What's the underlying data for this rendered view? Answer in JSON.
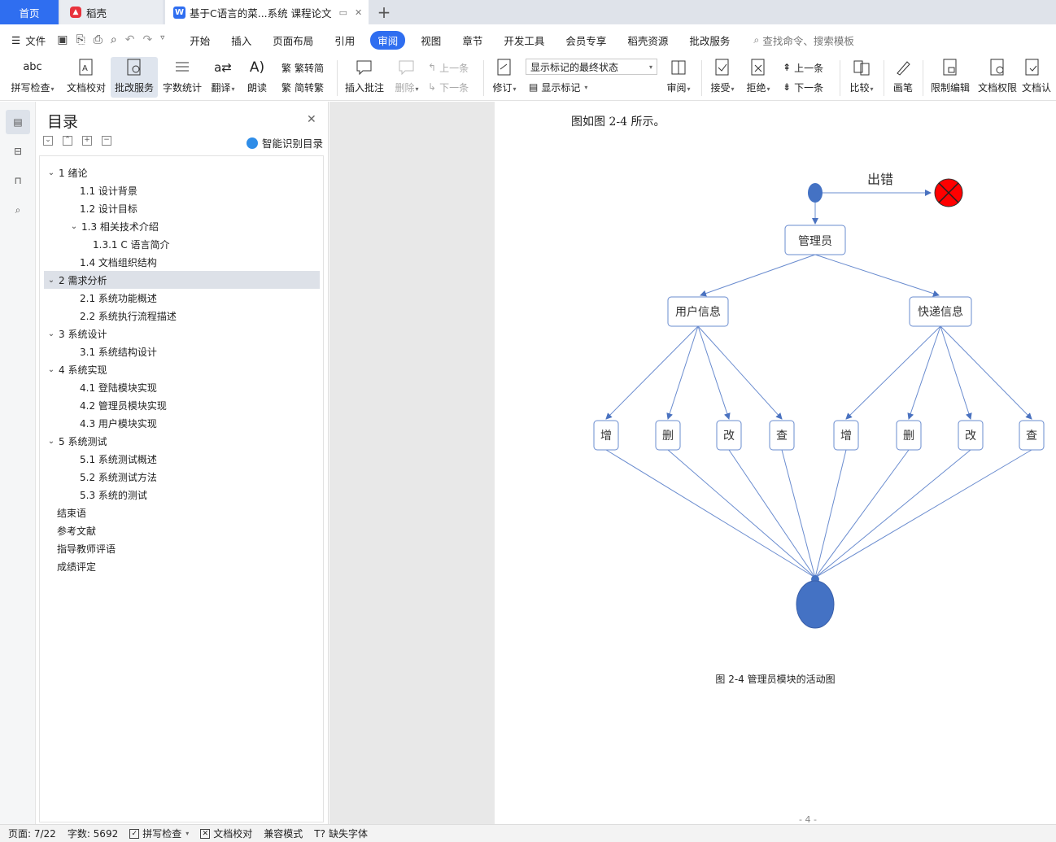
{
  "tabs": {
    "home": "首页",
    "daoke": "稻壳",
    "doc": "基于C语言的菜...系统 课程论文"
  },
  "menu": {
    "file": "文件",
    "items": [
      "开始",
      "插入",
      "页面布局",
      "引用",
      "审阅",
      "视图",
      "章节",
      "开发工具",
      "会员专享",
      "稻壳资源",
      "批改服务"
    ],
    "active": "审阅",
    "search_placeholder": "查找命令、搜索模板"
  },
  "ribbon": {
    "spell": "拼写检查",
    "proofread": "文档校对",
    "review_service": "批改服务",
    "word_count": "字数统计",
    "translate": "翻译",
    "read_aloud": "朗读",
    "trad": "繁转简",
    "simp": "简转繁",
    "insert_comment": "插入批注",
    "delete": "删除",
    "prev_comment": "上一条",
    "next_comment": "下一条",
    "revise": "修订",
    "status_select": "显示标记的最终状态",
    "show_markup": "显示标记",
    "review_pane": "审阅",
    "accept": "接受",
    "reject": "拒绝",
    "prev_change": "上一条",
    "next_change": "下一条",
    "compare": "比较",
    "pen": "画笔",
    "restrict": "限制编辑",
    "permission": "文档权限",
    "certify": "文档认"
  },
  "toc": {
    "title": "目录",
    "smart": "智能识别目录",
    "items": [
      {
        "text": "1  绪论",
        "level": 0,
        "chev": true
      },
      {
        "text": "1.1  设计背景",
        "level": 1,
        "chev": false
      },
      {
        "text": "1.2  设计目标",
        "level": 1,
        "chev": false
      },
      {
        "text": "1.3 相关技术介绍",
        "level": 1,
        "chev": true
      },
      {
        "text": "1.3.1 C 语言简介",
        "level": 2,
        "chev": false
      },
      {
        "text": "1.4  文档组织结构",
        "level": 1,
        "chev": false
      },
      {
        "text": "2  需求分析",
        "level": 0,
        "chev": true,
        "selected": true
      },
      {
        "text": "2.1  系统功能概述",
        "level": 1,
        "chev": false
      },
      {
        "text": "2.2  系统执行流程描述",
        "level": 1,
        "chev": false
      },
      {
        "text": "3  系统设计",
        "level": 0,
        "chev": true
      },
      {
        "text": "3.1  系统结构设计",
        "level": 1,
        "chev": false
      },
      {
        "text": "4  系统实现",
        "level": 0,
        "chev": true
      },
      {
        "text": "4.1  登陆模块实现",
        "level": 1,
        "chev": false
      },
      {
        "text": "4.2  管理员模块实现",
        "level": 1,
        "chev": false
      },
      {
        "text": "4.3  用户模块实现",
        "level": 1,
        "chev": false
      },
      {
        "text": "5  系统测试",
        "level": 0,
        "chev": true
      },
      {
        "text": "5.1  系统测试概述",
        "level": 1,
        "chev": false
      },
      {
        "text": "5.2  系统测试方法",
        "level": 1,
        "chev": false
      },
      {
        "text": "5.3  系统的测试",
        "level": 1,
        "chev": false
      },
      {
        "text": "结束语",
        "level": 0,
        "chev": false
      },
      {
        "text": "参考文献",
        "level": 0,
        "chev": false
      },
      {
        "text": "指导教师评语",
        "level": 0,
        "chev": false
      },
      {
        "text": "成绩评定",
        "level": 0,
        "chev": false
      }
    ]
  },
  "document": {
    "paragraph": "图如图 2-4 所示。",
    "diagram": {
      "error_label": "出错",
      "admin": "管理员",
      "user_info": "用户信息",
      "express_info": "快递信息",
      "ops": [
        "增",
        "删",
        "改",
        "查",
        "增",
        "删",
        "改",
        "查"
      ]
    },
    "caption": "图 2-4 管理员模块的活动图",
    "page_num": "- 4 -"
  },
  "status": {
    "page": "页面: 7/22",
    "words": "字数: 5692",
    "spell": "拼写检查",
    "proof": "文档校对",
    "compat": "兼容模式",
    "missing_font": "缺失字体"
  },
  "colors": {
    "accent": "#2f6ef0",
    "node_fill": "#4472c4",
    "error_fill": "#ff0000"
  }
}
